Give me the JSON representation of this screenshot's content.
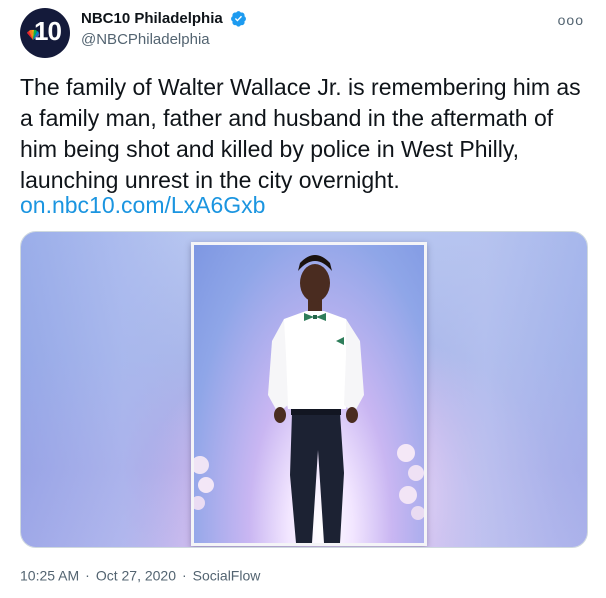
{
  "account": {
    "display_name": "NBC10 Philadelphia",
    "handle": "@NBCPhiladelphia",
    "avatar_text": "10",
    "verified_icon": "verified-badge-icon",
    "more_icon": "ooo"
  },
  "tweet": {
    "text": "The family of Walter Wallace Jr. is remembering him as a family man, father and husband in the aftermath of him being shot and killed by police in West Philly, launching unrest in the city overnight.",
    "link": "on.nbc10.com/LxA6Gxb"
  },
  "media": {
    "icon": "photo",
    "accent_colors": {
      "background": "#aab7ea",
      "frame": "#f4f4f7",
      "shirt": "#ffffff",
      "pants": "#1c2233",
      "bowtie": "#2e7d5a"
    }
  },
  "meta": {
    "time": "10:25 AM",
    "date": "Oct 27, 2020",
    "source": "SocialFlow",
    "separator": "·"
  },
  "colors": {
    "text": "#0f1419",
    "secondary": "#536471",
    "link": "#1b95e0",
    "verified": "#1d9bf0"
  }
}
